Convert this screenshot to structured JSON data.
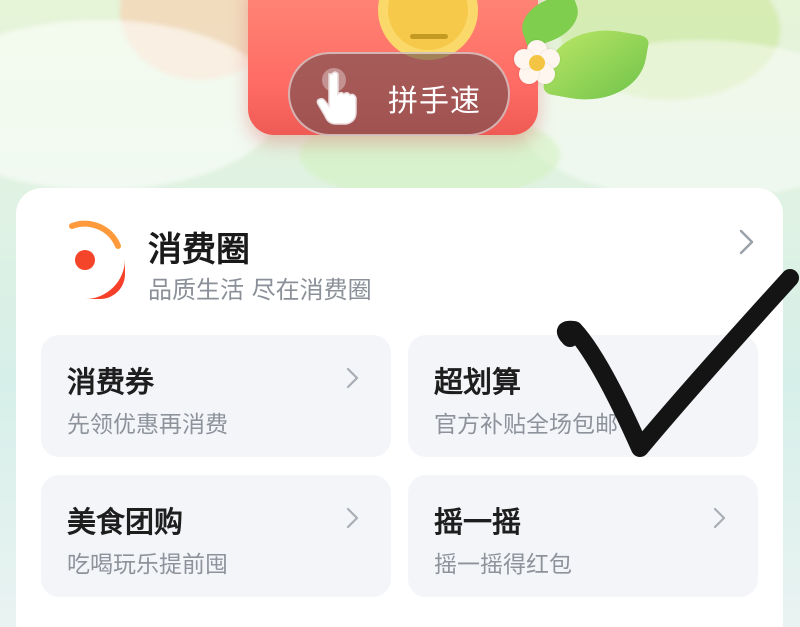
{
  "banner": {
    "button_label": "拼手速",
    "button_icon": "tap-hand-icon",
    "colors": {
      "box": "#ff6b64",
      "clock": "#f7c94a",
      "leaf": "#6cc24a"
    }
  },
  "card": {
    "title": "消费圈",
    "subtitle": "品质生活 尽在消费圈",
    "logo_icon": "consumption-circle-logo",
    "logo_color": "#ff5a1f",
    "chevron_icon": "chevron-right-icon"
  },
  "tiles": [
    {
      "title": "消费券",
      "subtitle": "先领优惠再消费",
      "has_chevron": true
    },
    {
      "title": "超划算",
      "subtitle": "官方补贴全场包邮",
      "has_chevron": false
    },
    {
      "title": "美食团购",
      "subtitle": "吃喝玩乐提前囤",
      "has_chevron": true
    },
    {
      "title": "摇一摇",
      "subtitle": "摇一摇得红包",
      "has_chevron": true
    }
  ],
  "overlay": {
    "icon": "checkmark-icon",
    "color": "#141414"
  }
}
